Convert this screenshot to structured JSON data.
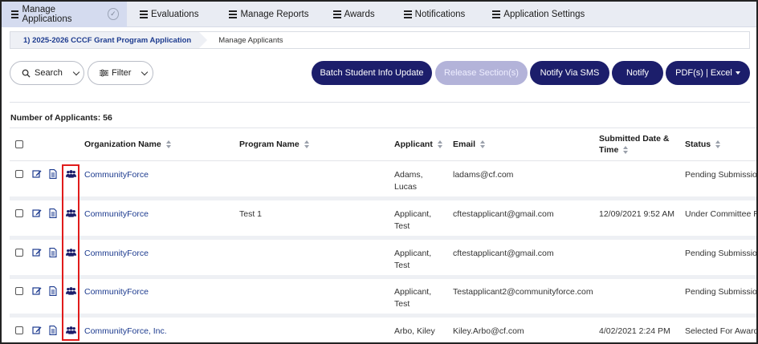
{
  "nav": {
    "items": [
      {
        "label": "Manage Applications"
      },
      {
        "label": "Evaluations"
      },
      {
        "label": "Manage Reports"
      },
      {
        "label": "Awards"
      },
      {
        "label": "Notifications"
      },
      {
        "label": "Application Settings"
      }
    ]
  },
  "breadcrumb": {
    "item1": "1) 2025-2026 CCCF Grant Program Application",
    "item2": "Manage Applicants"
  },
  "toolbar": {
    "search_label": "Search",
    "filter_label": "Filter",
    "batch_label": "Batch Student Info Update",
    "release_label": "Release Section(s)",
    "sms_label": "Notify Via SMS",
    "notify_label": "Notify",
    "pdf_label": "PDF(s) | Excel"
  },
  "count_label": "Number of Applicants: 56",
  "table": {
    "headers": {
      "org": "Organization Name",
      "program": "Program Name",
      "applicant": "Applicant",
      "email": "Email",
      "submitted1": "Submitted Date &",
      "submitted2": "Time",
      "status": "Status"
    },
    "rows": [
      {
        "org": "CommunityForce",
        "program": "",
        "applicant1": "Adams,",
        "applicant2": "Lucas",
        "email": "ladams@cf.com",
        "submitted": "",
        "status": "Pending Submission"
      },
      {
        "org": "CommunityForce",
        "program": "Test 1",
        "applicant1": "Applicant,",
        "applicant2": "Test",
        "email": "cftestapplicant@gmail.com",
        "submitted": "12/09/2021 9:52 AM",
        "status": "Under Committee Review"
      },
      {
        "org": "CommunityForce",
        "program": "",
        "applicant1": "Applicant,",
        "applicant2": "Test",
        "email": "cftestapplicant@gmail.com",
        "submitted": "",
        "status": "Pending Submission"
      },
      {
        "org": "CommunityForce",
        "program": "",
        "applicant1": "Applicant,",
        "applicant2": "Test",
        "email": "Testapplicant2@communityforce.com",
        "submitted": "",
        "status": "Pending Submission"
      },
      {
        "org": "CommunityForce, Inc.",
        "program": "",
        "applicant1": "Arbo, Kiley",
        "applicant2": "",
        "email": "Kiley.Arbo@cf.com",
        "submitted": "4/02/2021 2:24 PM",
        "status": "Selected For Award"
      }
    ]
  },
  "colors": {
    "nav_bg": "#e9ecf3",
    "primary": "#1c1e6b",
    "link": "#1d3b8f",
    "highlight": "#e01b1b"
  },
  "icons": [
    "hamburger-icon",
    "check-circle-icon",
    "search-icon",
    "filter-icon",
    "edit-icon",
    "document-icon",
    "users-icon"
  ]
}
